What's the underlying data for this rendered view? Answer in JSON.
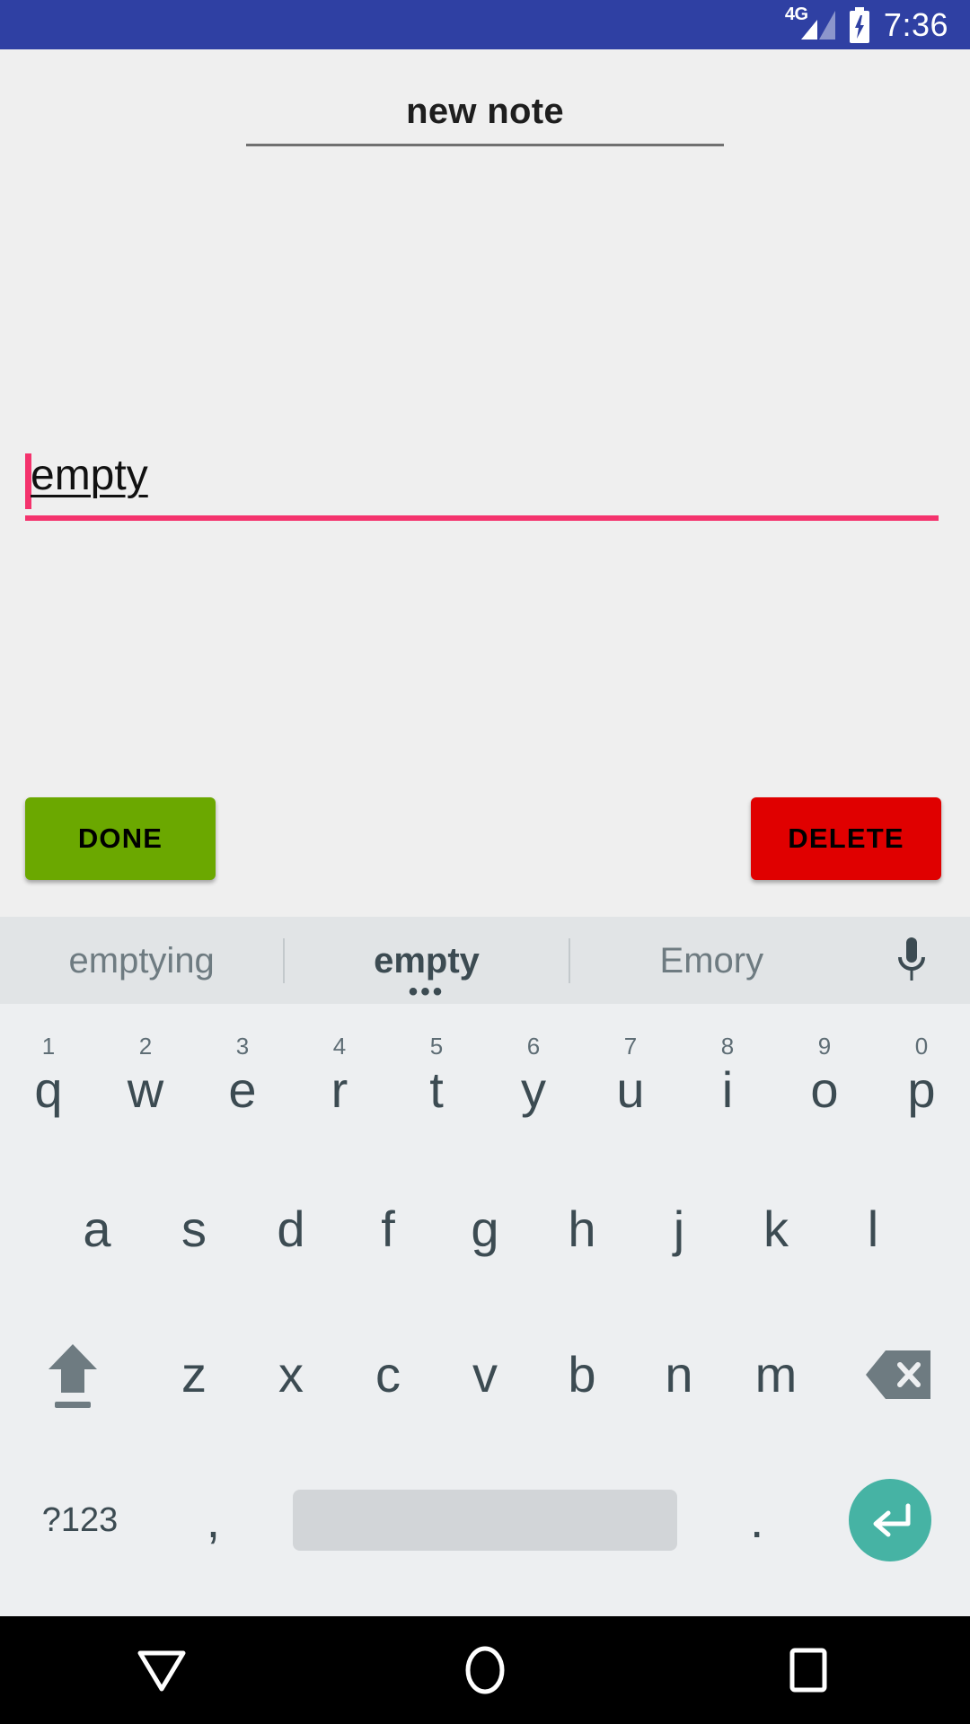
{
  "status_bar": {
    "network_label": "4G",
    "network_icon": "signal-bars-icon",
    "battery_icon": "battery-charging-icon",
    "clock": "7:36",
    "background_color": "#2F40A3"
  },
  "note": {
    "title": "new note",
    "body_value": "empty",
    "caret_color": "#F4336D",
    "focus_underline_color": "#F4336D"
  },
  "actions": {
    "done_label": "DONE",
    "done_color": "#6BA800",
    "delete_label": "DELETE",
    "delete_color": "#E00000"
  },
  "keyboard": {
    "suggestions": [
      {
        "text": "emptying",
        "active": false
      },
      {
        "text": "empty",
        "active": true,
        "more_indicator": "•••"
      },
      {
        "text": "Emory",
        "active": false
      }
    ],
    "mic_icon": "microphone-icon",
    "row1": [
      {
        "letter": "q",
        "number": "1"
      },
      {
        "letter": "w",
        "number": "2"
      },
      {
        "letter": "e",
        "number": "3"
      },
      {
        "letter": "r",
        "number": "4"
      },
      {
        "letter": "t",
        "number": "5"
      },
      {
        "letter": "y",
        "number": "6"
      },
      {
        "letter": "u",
        "number": "7"
      },
      {
        "letter": "i",
        "number": "8"
      },
      {
        "letter": "o",
        "number": "9"
      },
      {
        "letter": "p",
        "number": "0"
      }
    ],
    "row2": [
      "a",
      "s",
      "d",
      "f",
      "g",
      "h",
      "j",
      "k",
      "l"
    ],
    "row3": [
      "z",
      "x",
      "c",
      "v",
      "b",
      "n",
      "m"
    ],
    "shift_icon": "shift-arrow-icon",
    "backspace_icon": "backspace-icon",
    "symbols_label": "?123",
    "comma_label": ",",
    "space_label": "",
    "period_label": ".",
    "enter_icon": "enter-return-icon",
    "enter_color": "#46B3A4",
    "background_color": "#EDEFF1",
    "suggestion_bar_color": "#E1E4E6"
  },
  "nav_bar": {
    "back_icon": "collapse-keyboard-triangle-icon",
    "home_icon": "home-circle-icon",
    "recents_icon": "recents-square-icon",
    "background_color": "#000000"
  }
}
